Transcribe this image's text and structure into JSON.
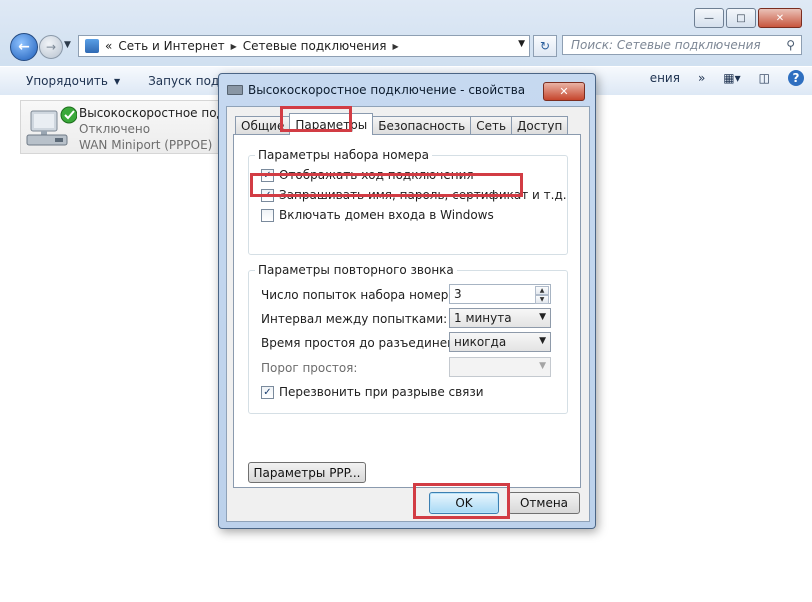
{
  "explorer": {
    "address": {
      "breadcrumbs": [
        "«",
        "Сеть и Интернет",
        "Сетевые подключения"
      ]
    },
    "search_placeholder": "Поиск: Сетевые подключения",
    "toolbar": {
      "organize": "Упорядочить",
      "launch": "Запуск подкл",
      "right_partial": "ения",
      "more": "»"
    },
    "connection": {
      "name": "Высокоскоростное подкл",
      "status": "Отключено",
      "device": "WAN Miniport (PPPOE)"
    }
  },
  "dialog": {
    "title": "Высокоскоростное подключение - свойства",
    "tabs": [
      "Общие",
      "Параметры",
      "Безопасность",
      "Сеть",
      "Доступ"
    ],
    "active_tab": "Параметры",
    "dial_group": {
      "title": "Параметры набора номера",
      "options": [
        {
          "label": "Отображать ход подключения",
          "checked": true
        },
        {
          "label": "Запрашивать имя, пароль, сертификат и т.д.",
          "checked": true
        },
        {
          "label": "Включать домен входа в Windows",
          "checked": false
        }
      ]
    },
    "redial_group": {
      "title": "Параметры повторного звонка",
      "attempts_label": "Число попыток набора номера:",
      "attempts_value": "3",
      "interval_label": "Интервал между попытками:",
      "interval_value": "1 минута",
      "idle_label": "Время простоя до разъединения:",
      "idle_value": "никогда",
      "threshold_label": "Порог простоя:",
      "threshold_value": "",
      "redial_label": "Перезвонить при разрыве связи",
      "redial_checked": true
    },
    "ppp_button": "Параметры PPP...",
    "ok_button": "OK",
    "cancel_button": "Отмена"
  },
  "highlight_color": "#d23c44"
}
